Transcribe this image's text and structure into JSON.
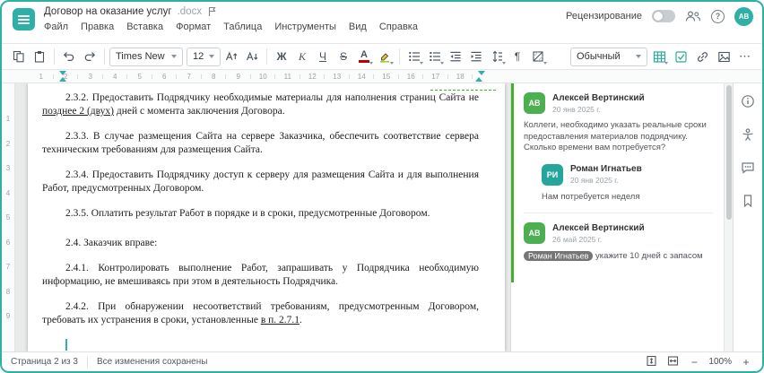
{
  "app": {
    "title": "Договор на оказание услуг",
    "title_ext": ".docx"
  },
  "header": {
    "menus": [
      "Файл",
      "Правка",
      "Вставка",
      "Формат",
      "Таблица",
      "Инструменты",
      "Вид",
      "Справка"
    ],
    "review_label": "Рецензирование",
    "help_label": "?",
    "user_initials": "АВ"
  },
  "toolbar": {
    "font_name": "Times New",
    "font_size": "12",
    "bold": "Ж",
    "italic": "К",
    "underline": "Ч",
    "strikethrough": "S",
    "font_color_letter": "А",
    "paragraph_mark": "¶",
    "style_name": "Обычный",
    "more": "⋯"
  },
  "ruler": {
    "horizontal": [
      "1",
      "2",
      "3",
      "4",
      "5",
      "6",
      "7",
      "8",
      "9",
      "10",
      "11",
      "12",
      "13",
      "14",
      "15",
      "16",
      "17",
      "18"
    ],
    "vertical": [
      "1",
      "2",
      "3",
      "4",
      "5",
      "6",
      "7",
      "8",
      "9"
    ]
  },
  "document": {
    "p1": {
      "a": "2.3.2. Предоставить Подрядчику необходимые материалы для наполнения страниц Сайта не ",
      "ins": "позднее 2 (двух)",
      "b": " дней с момента заключения Договора."
    },
    "p2": "2.3.3. В случае размещения Сайта на сервере Заказчика, обеспечить соответствие сервера техническим требованиям для размещения Сайта.",
    "p3": "2.3.4. Предоставить Подрядчику доступ к серверу для размещения Сайта и для выполнения Работ, предусмотренных Договором.",
    "p4": "2.3.5. Оплатить результат Работ в порядке и в сроки, предусмотренные Договором.",
    "p5": "2.4. Заказчик вправе:",
    "p6": "2.4.1. Контролировать выполнение Работ, запрашивать у Подрядчика необходимую информацию, не вмешиваясь при этом в деятельность Подрядчика.",
    "p7": {
      "a": "2.4.2. При обнаружении несоответствий требованиям, предусмотренным Договором, требовать их устранения в сроки, установленные ",
      "ins": "в п. 2.7.1",
      "b": "."
    }
  },
  "comments": {
    "c1": {
      "initials": "АВ",
      "name": "Алексей Вертинский",
      "date": "20 янв 2025 г.",
      "text": "Коллеги, необходимо указать реальные сроки предоставления материалов подрядчику. Сколько времени вам потребуется?"
    },
    "c2": {
      "initials": "РИ",
      "name": "Роман Игнатьев",
      "date": "20 янв 2025 г.",
      "text": "Нам потребуется неделя"
    },
    "c3": {
      "initials": "АВ",
      "name": "Алексей Вертинский",
      "date": "26 май 2025 г.",
      "mention": "Роман Игнатьев",
      "text": "укажите 10 дней с запасом"
    }
  },
  "statusbar": {
    "page_info": "Страница 2 из 3",
    "save_status": "Все изменения сохранены",
    "zoom": "100%",
    "zoom_out": "−",
    "zoom_in": "+"
  },
  "colors": {
    "accent_teal": "#2fb0a6",
    "comment_accent_green": "#43b02a",
    "avatar_green": "#4caf50",
    "avatar_teal": "#26a69a",
    "font_color_bar": "#c00000"
  }
}
